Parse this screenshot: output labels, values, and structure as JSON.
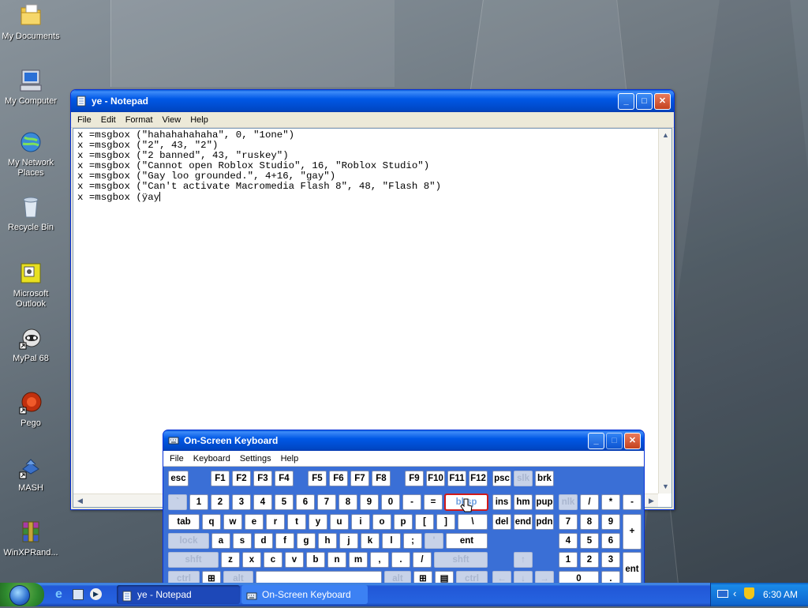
{
  "desktop": {
    "icons": [
      {
        "label": "My Documents",
        "icon": "folder-icon"
      },
      {
        "label": "My Computer",
        "icon": "computer-icon"
      },
      {
        "label": "My Network Places",
        "icon": "network-icon"
      },
      {
        "label": "Recycle Bin",
        "icon": "recycle-bin-icon"
      },
      {
        "label": "Microsoft Outlook",
        "icon": "outlook-icon"
      },
      {
        "label": "MyPal 68",
        "icon": "mypal-icon"
      },
      {
        "label": "Pego",
        "icon": "pego-icon"
      },
      {
        "label": "MASH",
        "icon": "mash-icon"
      },
      {
        "label": "WinXPRand...",
        "icon": "winrar-icon"
      }
    ]
  },
  "notepad": {
    "title": "ye - Notepad",
    "menu": [
      "File",
      "Edit",
      "Format",
      "View",
      "Help"
    ],
    "lines": [
      "x =msgbox (\"hahahahahaha\", 0, \"1one\")",
      "x =msgbox (\"2\", 43, \"2\")",
      "x =msgbox (\"2 banned\", 43, \"ruskey\")",
      "x =msgbox (\"Cannot open Roblox Studio\", 16, \"Roblox Studio\")",
      "x =msgbox (\"Gay loo grounded.\", 4+16, \"gay\")",
      "x =msgbox (\"Can't activate Macromedia Flash 8\", 48, \"Flash 8\")",
      "x =msgbox (ÿay"
    ]
  },
  "osk": {
    "title": "On-Screen Keyboard",
    "menu": [
      "File",
      "Keyboard",
      "Settings",
      "Help"
    ]
  },
  "taskbar": {
    "tasks": [
      "ye - Notepad",
      "On-Screen Keyboard"
    ],
    "clock": "6:30 AM"
  }
}
